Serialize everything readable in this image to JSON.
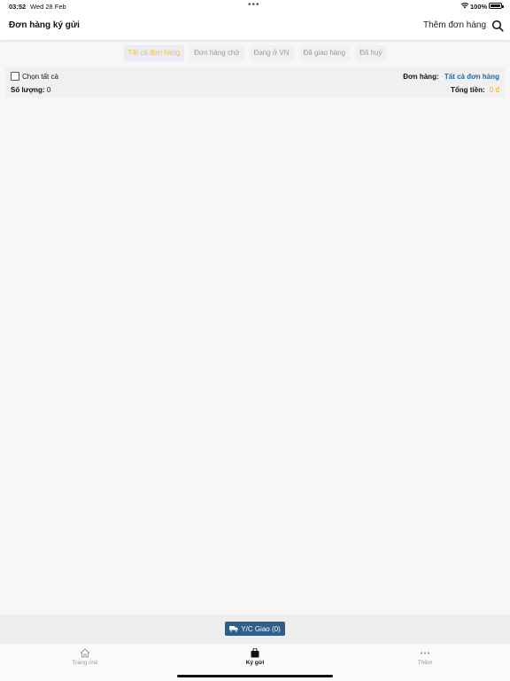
{
  "status_bar": {
    "time": "03:52",
    "date": "Wed 28 Feb",
    "battery": "100%"
  },
  "nav": {
    "title": "Đơn hàng ký gửi",
    "add_order": "Thêm đơn hàng"
  },
  "filters": {
    "tabs": [
      "Tất cả đơn hàng",
      "Đơn hàng chờ",
      "Đang ở VN",
      "Đã giao hàng",
      "Đã huỷ"
    ],
    "active_index": 0
  },
  "summary": {
    "select_all": "Chọn tất cả",
    "quantity_label": "Số lượng:",
    "quantity_value": "0",
    "orders_label": "Đơn hàng:",
    "orders_value": "Tất cả đơn hàng",
    "total_label": "Tổng tiền:",
    "total_value": "0 đ"
  },
  "action": {
    "deliver_label": "Y/C Giao (0)"
  },
  "tab_bar": {
    "items": [
      {
        "label": "Trang chủ",
        "icon": "home-icon"
      },
      {
        "label": "Ký gửi",
        "icon": "bag-icon"
      },
      {
        "label": "Thêm",
        "icon": "more-icon"
      }
    ],
    "active_index": 1
  },
  "colors": {
    "accent_blue": "#1f66b0",
    "button_blue": "#2e5f88",
    "highlight_yellow": "#f0c040"
  }
}
